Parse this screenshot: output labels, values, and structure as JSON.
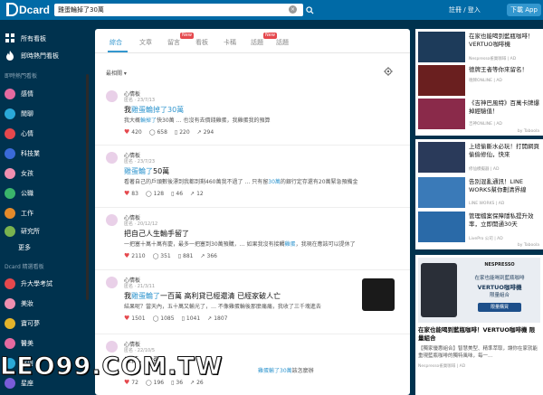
{
  "header": {
    "logo": "Dcard",
    "search_value": "雞蛋輪掉了30萬",
    "login_label": "註冊 / 登入",
    "app_button": "下載 App"
  },
  "sidebar": {
    "top_items": [
      {
        "label": "所有看板",
        "icon": "grid-icon"
      },
      {
        "label": "即時熱門看板",
        "icon": "fire-icon"
      }
    ],
    "section1_heading": "即時熱門看板",
    "boards": [
      {
        "label": "感情",
        "color": "#e66aa0"
      },
      {
        "label": "閒聊",
        "color": "#2aa9d8"
      },
      {
        "label": "心情",
        "color": "#e5484d"
      },
      {
        "label": "科技業",
        "color": "#3a6ad8"
      },
      {
        "label": "女孩",
        "color": "#f08fb0"
      },
      {
        "label": "公職",
        "color": "#3ab56b"
      },
      {
        "label": "工作",
        "color": "#e58a2a"
      },
      {
        "label": "研究所",
        "color": "#7ab34f"
      }
    ],
    "more_label": "更多",
    "section2_heading": "Dcard 精選看板",
    "featured": [
      {
        "label": "升大學考試",
        "color": "#e5484d"
      },
      {
        "label": "美妝",
        "color": "#f08fb0"
      },
      {
        "label": "寶可夢",
        "color": "#e5b42a"
      },
      {
        "label": "醫美",
        "color": "#e66aa0"
      },
      {
        "label": "穿搭",
        "color": "#2aa9d8"
      },
      {
        "label": "星座",
        "color": "#7a5cd8"
      }
    ]
  },
  "tabs": [
    {
      "label": "綜合",
      "active": true
    },
    {
      "label": "文章",
      "active": false
    },
    {
      "label": "留言",
      "active": false,
      "badge": "New"
    },
    {
      "label": "看板",
      "active": false
    },
    {
      "label": "卡稱",
      "active": false
    },
    {
      "label": "話題",
      "active": false,
      "badge": "New"
    },
    {
      "label": "話題",
      "active": false
    }
  ],
  "filter_label": "最相關 ▾",
  "posts": [
    {
      "board": "心情板",
      "meta": "匿名 · 23/7/13",
      "title_pre": "我",
      "title_hl": "雞蛋輪掉了30萬",
      "title_post": "",
      "excerpt_pre": "我大概",
      "excerpt_hl": "輪掉了",
      "excerpt_post": "快30萬 … 也沒有去價錢雞蛋，我雞蛋我的預算",
      "likes": "420",
      "comments": "658",
      "saves": "220",
      "shares": "294"
    },
    {
      "board": "心情板",
      "meta": "匿名 · 23/7/23",
      "title_pre": "",
      "title_hl": "雞蛋輪了",
      "title_post": "50萬",
      "excerpt_pre": "看著自己的戶頭數後漂到我都到剩460萬我不過了 … 只有留",
      "excerpt_hl": "30萬",
      "excerpt_post": "的銀行定存還有20萬緊急預備金",
      "likes": "83",
      "comments": "128",
      "saves": "46",
      "shares": "12"
    },
    {
      "board": "心情板",
      "meta": "匿名 · 20/12/12",
      "title_pre": "把自己人生輸手留了",
      "title_hl": "",
      "title_post": "",
      "excerpt_pre": "一把塞十萬十萬有慶，最多一把塞到30萬預購，… 如果我沒有接觸",
      "excerpt_hl": "雞蛋",
      "excerpt_post": "，我現在應該可以提休了",
      "likes": "2110",
      "comments": "351",
      "saves": "881",
      "shares": "366"
    },
    {
      "board": "心情板",
      "meta": "匿名 · 21/3/11",
      "title_pre": "我",
      "title_hl": "雞蛋輪了",
      "title_post": "一百萬 高利貸已經還清 已經家破人亡",
      "excerpt_pre": "結果呢？當天內，五十萬又輸光了，… 不像雞蛋輪後那麼痛痛，我收了三千塊進去",
      "excerpt_hl": "",
      "excerpt_post": "",
      "likes": "1501",
      "comments": "1085",
      "saves": "1041",
      "shares": "1807"
    },
    {
      "board": "心情板",
      "meta": "匿名 · 22/10/5",
      "title_pre": "三萬，雞蛋",
      "title_hl": "",
      "title_post": "",
      "excerpt_pre": "",
      "excerpt_hl": "雞蛋輸了30萬",
      "excerpt_post": "該怎麼辦",
      "likes": "72",
      "comments": "196",
      "saves": "36",
      "shares": "26"
    }
  ],
  "ads": {
    "card1": [
      {
        "text": "在家也能喝到藍瓶咖啡！VERTUO咖啡機",
        "src": "Nespresso雀巢咖啡 | AD",
        "img": "#1d3b5a"
      },
      {
        "text": "德牌王者等你來留名！",
        "src": "德牌ONLINE | AD",
        "img": "#6a1f1f"
      },
      {
        "text": "《吉神巴風特》百萬卡牌爆掉經驗值！",
        "src": "吉神ONLINE | AD",
        "img": "#8a2a4a"
      }
    ],
    "card1_footer": "by Taboola",
    "card2": [
      {
        "text": "上班偷斷水必玩！打開網頁偷偷修仙，快來",
        "src": "修仙模擬器 | AD",
        "img": "#2a3a5a"
      },
      {
        "text": "告別混亂通訊！LINE WORKS幫你劃清界線",
        "src": "LINE WORKS | AD",
        "img": "#3a7ab8"
      },
      {
        "text": "管理檔案保障隱私提升效率，立即開通30天",
        "src": "LivePro 公司 | AD",
        "img": "#2a6aa8"
      }
    ],
    "card2_footer": "by Taboola",
    "promo": {
      "banner_brand": "NESPRESSO",
      "banner_line1": "在家也能喝到藍瓶咖啡",
      "banner_line2": "VERTUO咖啡機",
      "banner_line3": "限量組合",
      "banner_cta": "限量購買",
      "title": "在家也能喝到藍瓶咖啡！VERTUO咖啡機 限量組合",
      "desc": "【獨家優惠組合】智慧美型、精準萃取，讓你在家就能重現藍瓶咖啡的獨特風味，每一...",
      "src": "Nespresso雀巢咖啡 | AD"
    }
  },
  "watermark": "LEO99.COM.TW"
}
